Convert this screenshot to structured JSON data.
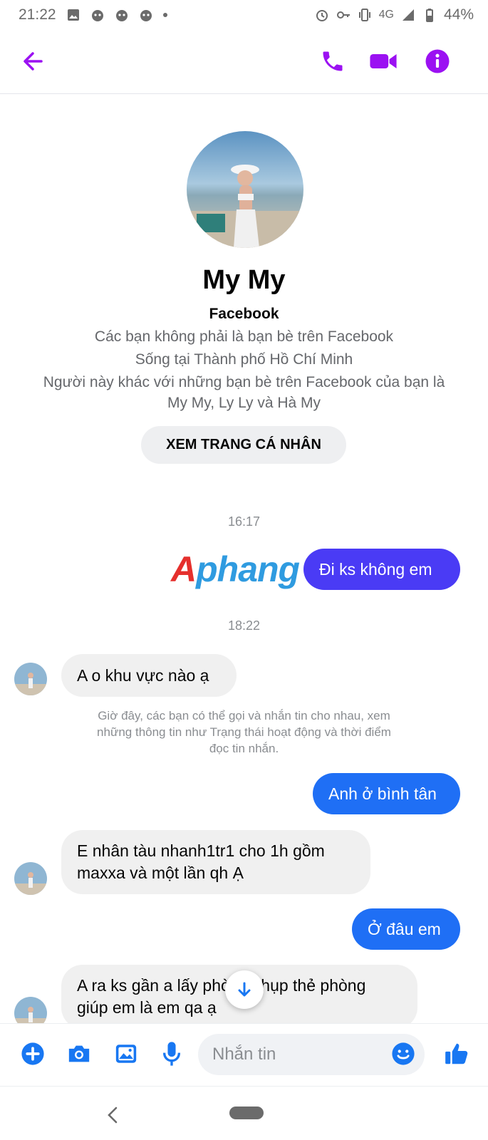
{
  "status_bar": {
    "time": "21:22",
    "network": "4G",
    "battery": "44%",
    "icons_left": [
      "gallery-icon",
      "messenger-cat-icon",
      "messenger-cat-icon",
      "messenger-cat-icon",
      "more-dot-icon"
    ],
    "icons_right": [
      "alarm-icon",
      "key-icon",
      "vibrate-icon",
      "signal-icon",
      "battery-icon"
    ]
  },
  "header": {
    "icons": [
      "back-arrow-icon",
      "phone-icon",
      "video-icon",
      "info-icon"
    ],
    "accent_color": "#9b11f2"
  },
  "profile": {
    "name": "My My",
    "source": "Facebook",
    "not_friends": "Các bạn không phải là bạn bè trên Facebook",
    "lives_in": "Sống tại Thành phố Hồ Chí Minh",
    "mutual_line1": "Người này khác với những bạn bè trên Facebook của bạn là",
    "mutual_line2": "My My, Ly Ly và Hà My",
    "view_profile_label": "XEM TRANG CÁ NHÂN"
  },
  "conversation": {
    "time_1": "16:17",
    "time_2": "18:22",
    "watermark": "Aphang",
    "messages": [
      {
        "from": "me",
        "text": "Đi ks không em"
      },
      {
        "from": "them",
        "text": "A o khu vực nào ạ"
      },
      {
        "from": "me",
        "text": "Anh ở bình tân"
      },
      {
        "from": "them",
        "line1": "E nhân tàu nhanh1tr1 cho 1h gồm",
        "line2": "maxxa và một lần qh Ạ"
      },
      {
        "from": "me",
        "text": "Ở đâu em"
      },
      {
        "from": "them",
        "line1": "A ra ks gần a lấy phòng chụp thẻ phòng",
        "line2": "giúp em là em qa ạ"
      }
    ],
    "notice_line1": "Giờ đây, các bạn có thể gọi và nhắn tin cho nhau, xem",
    "notice_line2": "những thông tin như Trạng thái hoạt động và thời điểm",
    "notice_line3": "đọc tin nhắn."
  },
  "composer": {
    "placeholder": "Nhắn tin",
    "icons": [
      "plus-icon",
      "camera-icon",
      "image-icon",
      "mic-icon",
      "emoji-icon",
      "like-icon"
    ],
    "color": "#1877f2"
  },
  "nav": {
    "icons": [
      "nav-back-icon",
      "nav-home-pill-icon"
    ]
  }
}
